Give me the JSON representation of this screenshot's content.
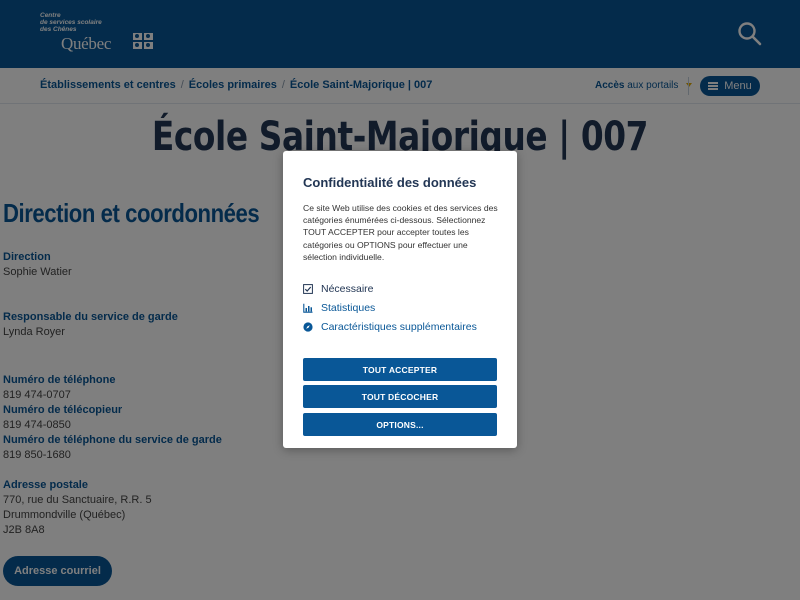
{
  "header": {
    "logo": {
      "subtitle_lines": [
        "Centre",
        "de services scolaire",
        "des Chênes"
      ],
      "name": "Québec"
    },
    "search_icon": "search-icon"
  },
  "breadcrumb": {
    "items": [
      "Établissements et centres",
      "Écoles primaires",
      "École Saint-Majorique | 007"
    ],
    "separator": "/"
  },
  "portals": {
    "bold": "Accès",
    "rest": "aux portails"
  },
  "menu": {
    "label": "Menu",
    "icon": "hamburger-icon"
  },
  "page": {
    "title": "École Saint-Majorique | 007",
    "section_title": "Direction et coordonnées",
    "fields": [
      {
        "label": "Direction",
        "values": [
          "Sophie Watier"
        ]
      },
      {
        "label": "Responsable du service de garde",
        "values": [
          "Lynda Royer"
        ]
      },
      {
        "label": "Numéro de téléphone",
        "values": [
          "819 474-0707"
        ]
      },
      {
        "label": "Numéro de télécopieur",
        "values": [
          "819 474-0850"
        ]
      },
      {
        "label": "Numéro de téléphone du service de garde",
        "values": [
          "819 850-1680"
        ]
      },
      {
        "label": "Adresse postale",
        "values": [
          "770, rue du Sanctuaire, R.R. 5",
          "Drummondville (Québec)",
          "J2B 8A8"
        ]
      }
    ],
    "email_button": "Adresse courriel"
  },
  "modal": {
    "title": "Confidentialité des données",
    "text": "Ce site Web utilise des cookies et des services des catégories énumérées ci-dessous. Sélectionnez TOUT ACCEPTER pour accepter toutes les catégories ou OPTIONS pour effectuer une sélection individuelle.",
    "categories": [
      {
        "label": "Nécessaire",
        "icon": "checkbox-icon"
      },
      {
        "label": "Statistiques",
        "icon": "bar-chart-icon"
      },
      {
        "label": "Caractéristiques supplémentaires",
        "icon": "compass-icon"
      }
    ],
    "buttons": {
      "accept_all": "TOUT ACCEPTER",
      "uncheck_all": "TOUT DÉCOCHER",
      "options": "OPTIONS..."
    }
  },
  "colors": {
    "brand_blue": "#095797",
    "dark_navy": "#223654",
    "overlay": "rgba(0,0,0,0.5)",
    "caret_yellow": "#e0a800"
  }
}
